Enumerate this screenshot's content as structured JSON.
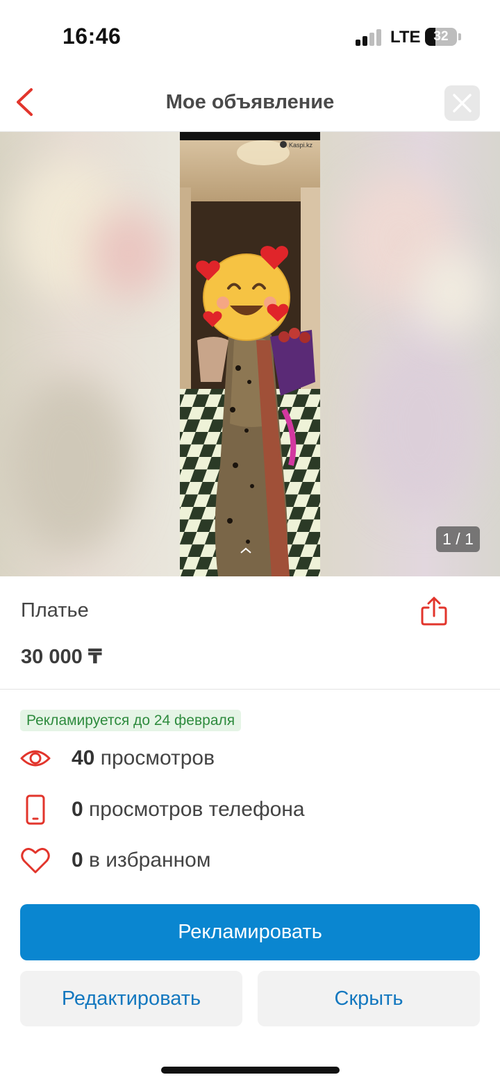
{
  "status_bar": {
    "time": "16:46",
    "network": "LTE",
    "battery": "32",
    "battery_level": 0.32
  },
  "nav": {
    "title": "Мое объявление"
  },
  "gallery": {
    "counter": "1 / 1",
    "watermark": "Kaspi.kz"
  },
  "listing": {
    "title": "Платье",
    "price": "30 000 ₸"
  },
  "promo": {
    "badge": "Рекламируется до 24 февраля"
  },
  "stats": [
    {
      "count": "40",
      "label": "просмотров",
      "icon": "eye-icon"
    },
    {
      "count": "0",
      "label": "просмотров телефона",
      "icon": "phone-icon"
    },
    {
      "count": "0",
      "label": "в избранном",
      "icon": "heart-icon"
    }
  ],
  "actions": {
    "promote": "Рекламировать",
    "edit": "Редактировать",
    "hide": "Скрыть"
  },
  "colors": {
    "accent_red": "#e2352c",
    "primary_blue": "#0a86d0",
    "link_blue": "#1478bf",
    "badge_green": "#2e8b3e",
    "badge_bg": "#e5f4e6"
  }
}
